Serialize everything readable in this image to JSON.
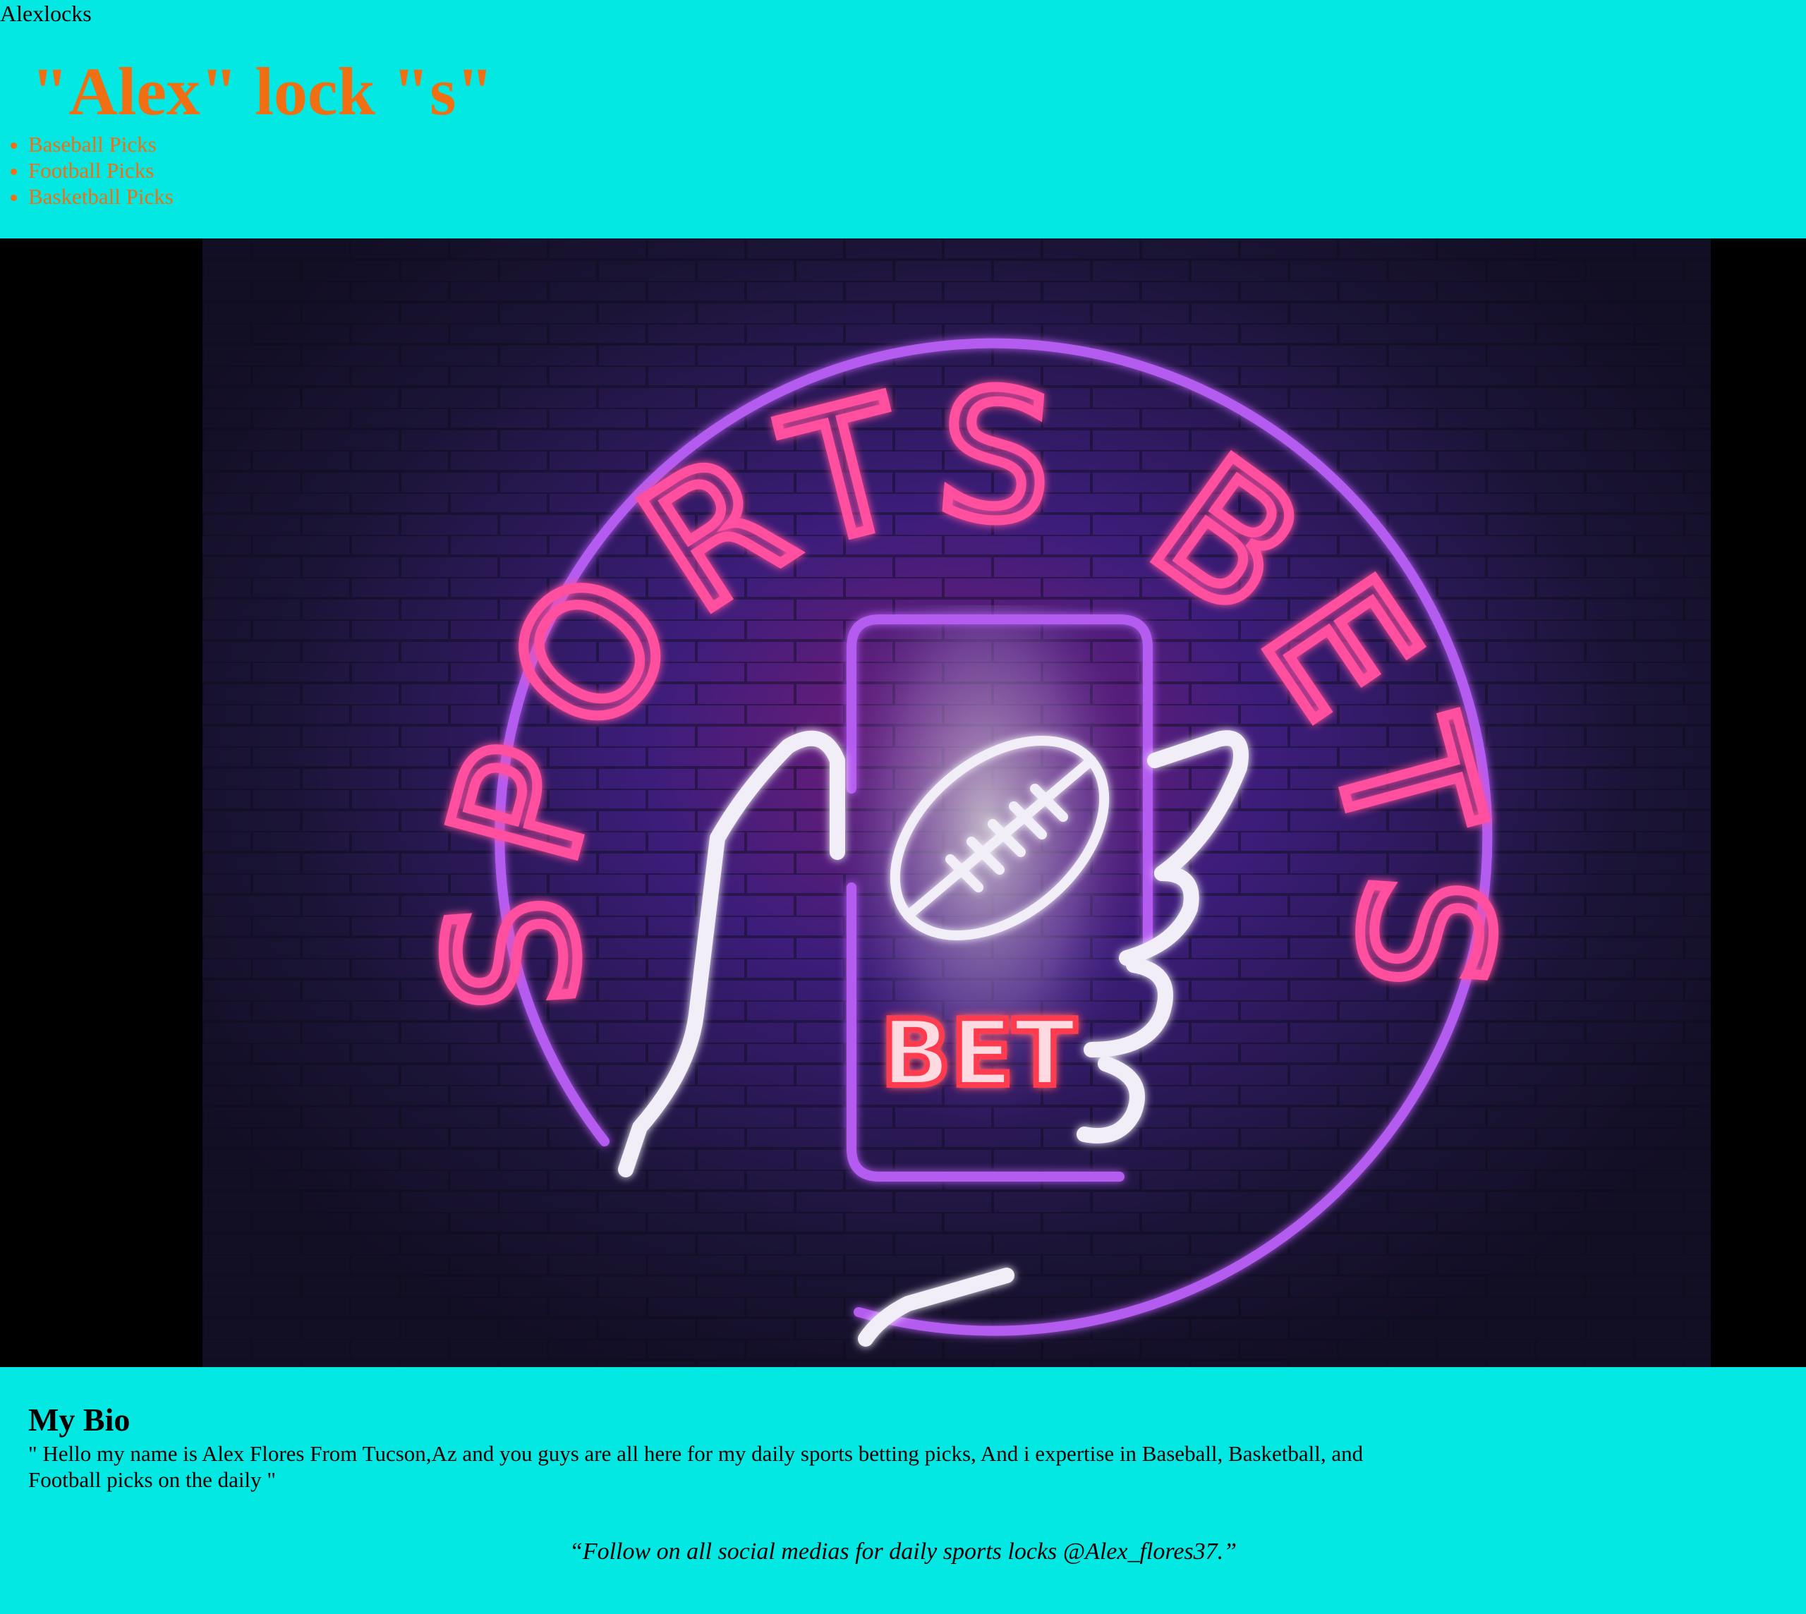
{
  "header": {
    "site_name": "Alexlocks",
    "title": "\"Alex\" lock \"s\"",
    "nav": [
      {
        "label": "Baseball Picks"
      },
      {
        "label": "Football Picks"
      },
      {
        "label": "Basketball Picks"
      }
    ]
  },
  "hero": {
    "image_name": "sports-bets-neon-sign",
    "sign_text": "SPORTS BETS",
    "phone_text": "BET",
    "colors": {
      "background": "#1b1436",
      "neon_purple": "#b55cf0",
      "neon_pink": "#ff4f9e",
      "neon_white": "#f2eef8",
      "neon_red": "#ff3b4f"
    }
  },
  "bio": {
    "heading": "My Bio",
    "text": "\" Hello my name is Alex Flores From Tucson,Az and you guys are all here for my daily sports betting picks, And i expertise in Baseball, Basketball, and Football picks on the daily \""
  },
  "footer": {
    "quote": "“Follow on all social medias for daily sports locks @Alex_flores37.”"
  },
  "colors": {
    "page_background": "#03e8e3",
    "accent": "#ef6f12",
    "text": "#000000"
  }
}
